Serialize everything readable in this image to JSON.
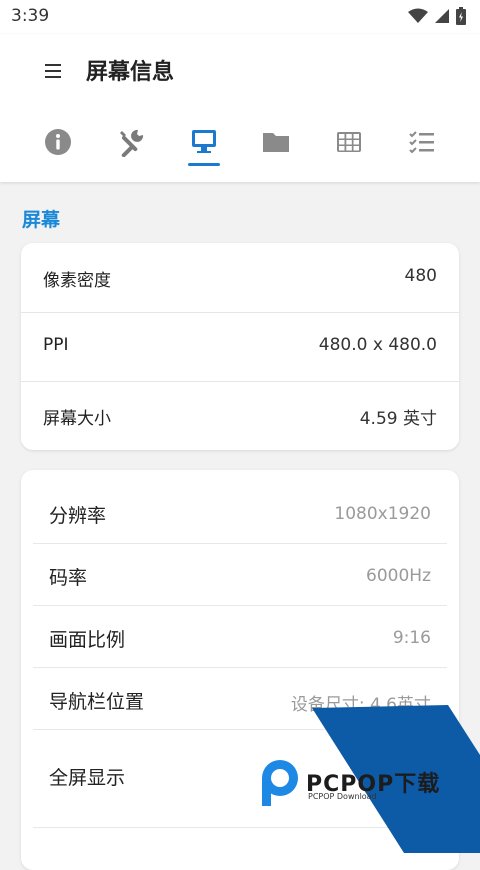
{
  "status_bar": {
    "time": "3:39"
  },
  "header": {
    "title": "屏幕信息"
  },
  "tabs": [
    {
      "name": "info-icon",
      "active": false
    },
    {
      "name": "tools-icon",
      "active": false
    },
    {
      "name": "monitor-icon",
      "active": true
    },
    {
      "name": "folder-icon",
      "active": false
    },
    {
      "name": "grid-icon",
      "active": false
    },
    {
      "name": "checklist-icon",
      "active": false
    }
  ],
  "section": {
    "title": "屏幕"
  },
  "card1": {
    "rows": [
      {
        "label": "像素密度",
        "value": "480"
      },
      {
        "label": "PPI",
        "value": "480.0 x 480.0"
      },
      {
        "label": "屏幕大小",
        "value": "4.59 英寸"
      }
    ]
  },
  "card2": {
    "rows": [
      {
        "label": "分辨率",
        "value": "1080x1920"
      },
      {
        "label": "码率",
        "value": "6000Hz"
      },
      {
        "label": "画面比例",
        "value": "9:16"
      },
      {
        "label": "导航栏位置",
        "value": "设备尺寸: 4.6英寸"
      },
      {
        "label": "全屏显示",
        "value": ""
      }
    ]
  },
  "watermark": {
    "brand": "PCPOP下载",
    "subtitle": "PCPOP Download"
  },
  "colors": {
    "accent": "#1b7ad0",
    "section_title": "#1b88d8",
    "watermark_blue": "#0d5aa7"
  }
}
